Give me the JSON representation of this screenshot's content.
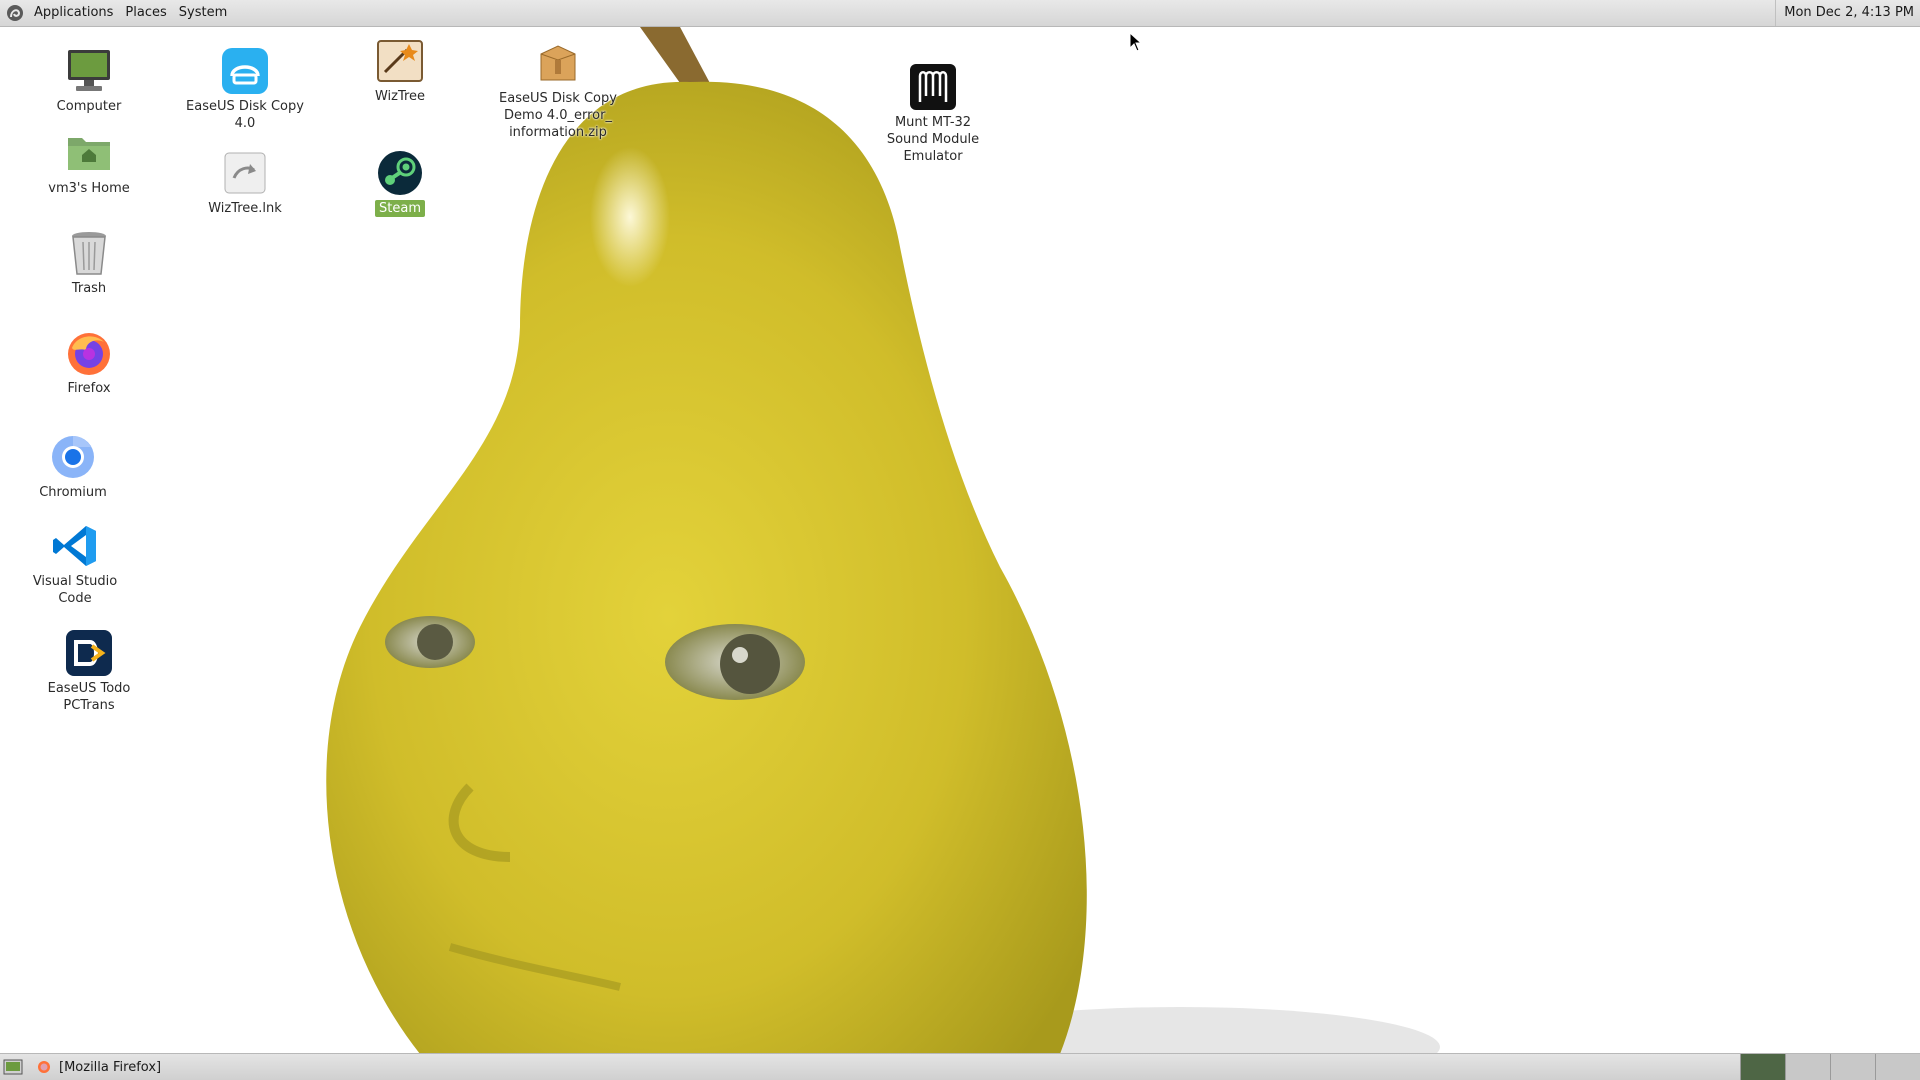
{
  "top_panel": {
    "menus": [
      "Applications",
      "Places",
      "System"
    ],
    "clock": "Mon Dec  2,  4:13 PM"
  },
  "desktop_icons": [
    {
      "id": "computer",
      "label": "Computer",
      "icon": "computer-icon"
    },
    {
      "id": "home",
      "label": "vm3's Home",
      "icon": "home-folder-icon"
    },
    {
      "id": "trash",
      "label": "Trash",
      "icon": "trash-icon"
    },
    {
      "id": "firefox",
      "label": "Firefox",
      "icon": "firefox-icon"
    },
    {
      "id": "chromium",
      "label": "Chromium",
      "icon": "chromium-icon"
    },
    {
      "id": "vscode",
      "label": "Visual Studio Code",
      "icon": "vscode-icon"
    },
    {
      "id": "pctrans",
      "label": "EaseUS Todo PCTrans",
      "icon": "easeus-pctrans-icon"
    },
    {
      "id": "diskcopy",
      "label": "EaseUS Disk Copy 4.0",
      "icon": "easeus-disk-copy-icon"
    },
    {
      "id": "wiztree_lnk",
      "label": "WizTree.lnk",
      "icon": "shortcut-icon"
    },
    {
      "id": "wiztree",
      "label": "WizTree",
      "icon": "wiztree-icon"
    },
    {
      "id": "steam",
      "label": "Steam",
      "icon": "steam-icon"
    },
    {
      "id": "diskcopy_zip",
      "label": "EaseUS Disk Copy Demo 4.0_error_ information.zip",
      "icon": "zip-archive-icon"
    },
    {
      "id": "munt",
      "label": "Munt MT-32 Sound Module Emulator",
      "icon": "munt-icon"
    }
  ],
  "bottom_panel": {
    "task_label": "[Mozilla Firefox]",
    "workspace_count": 4,
    "active_workspace": 1
  },
  "colors": {
    "selection": "#7daf4a",
    "panel": "#d8d8d8",
    "pear": "#d4c232"
  }
}
